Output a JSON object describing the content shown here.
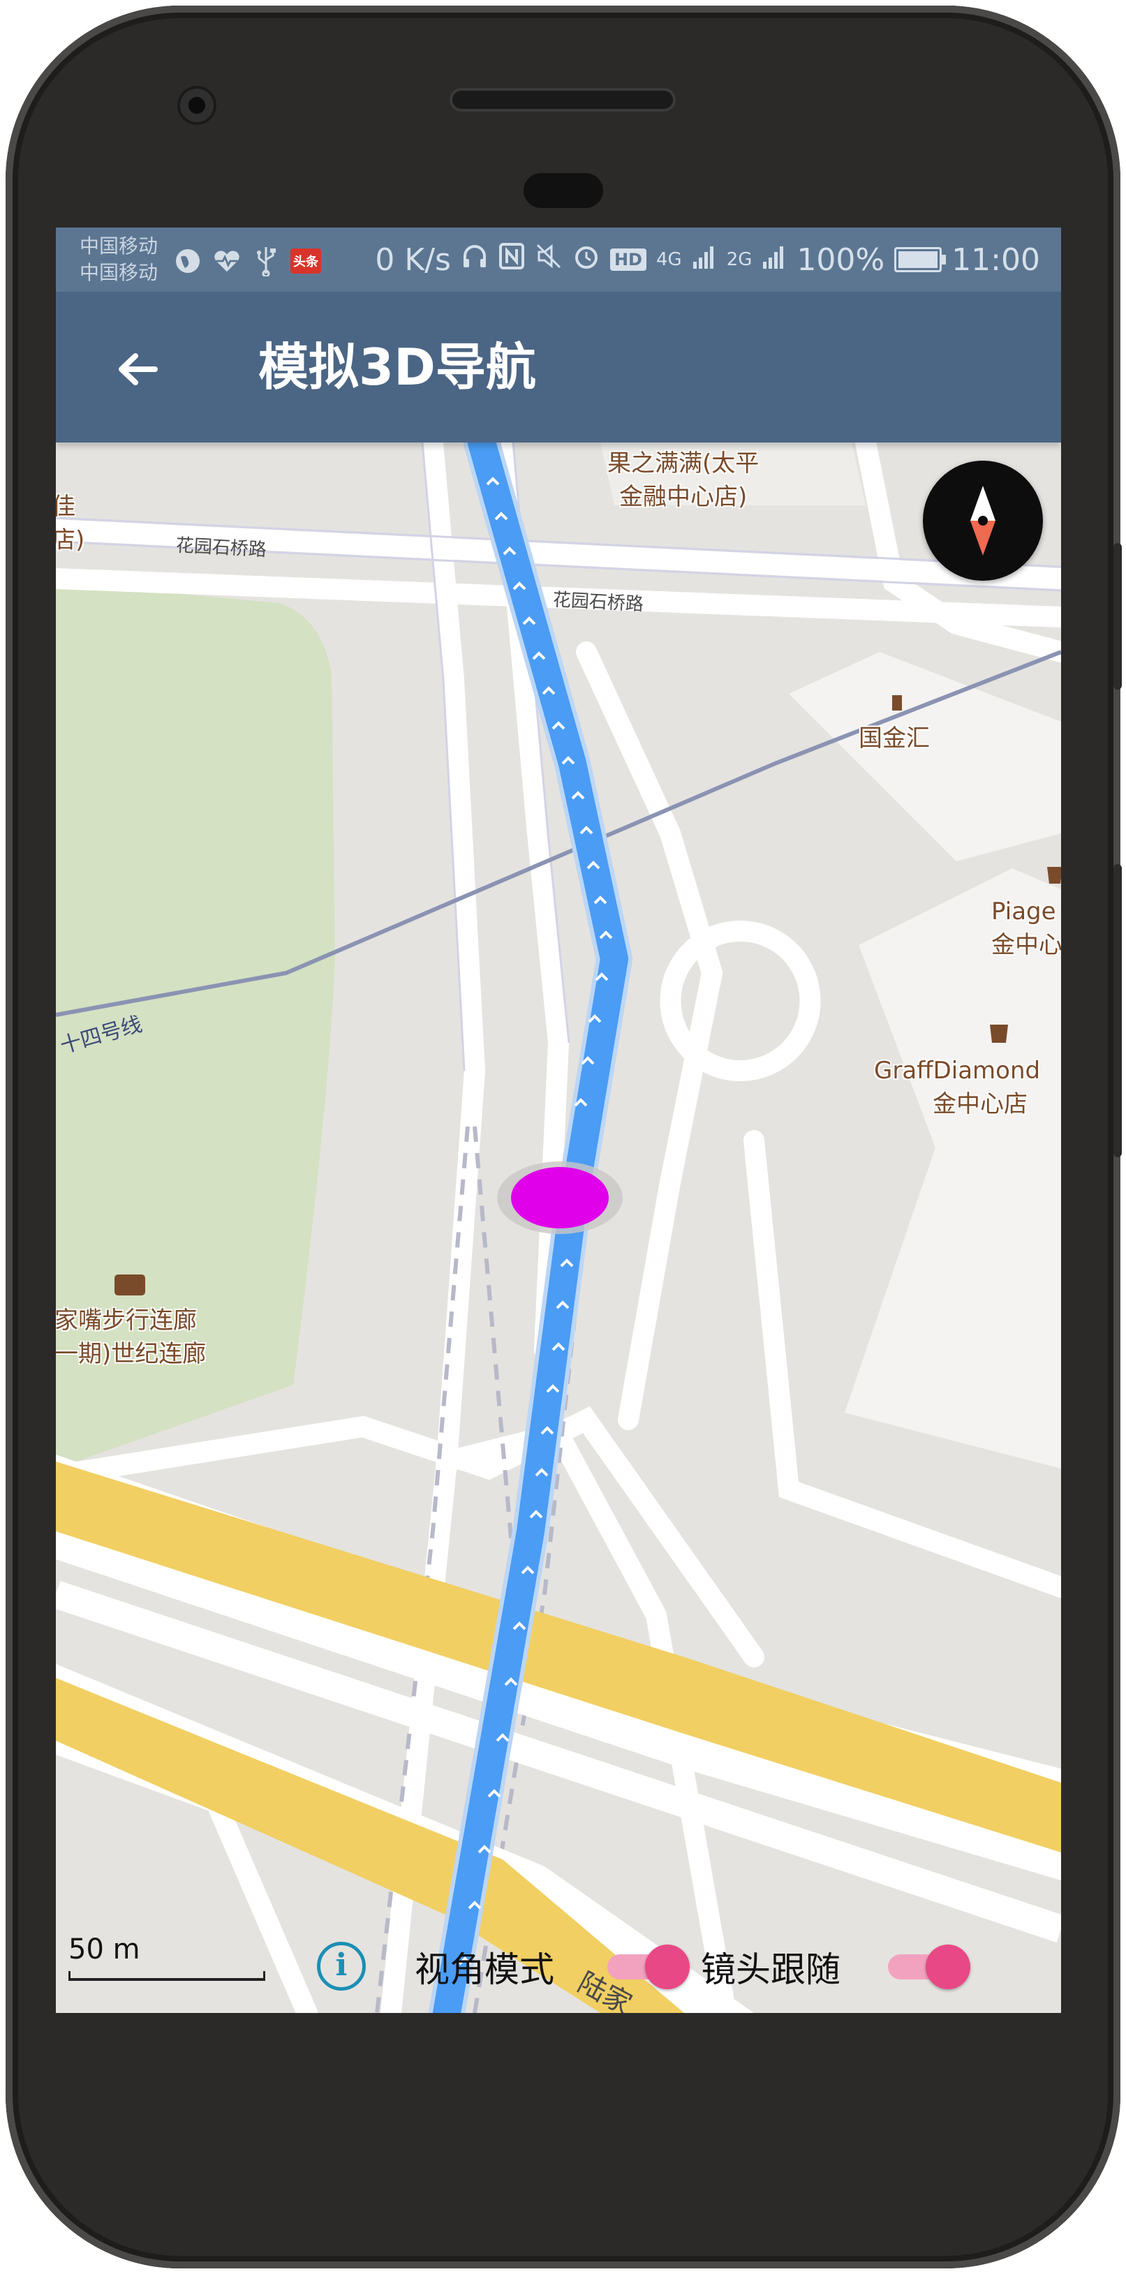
{
  "status_bar": {
    "carrier_1": "中国移动",
    "carrier_2": "中国移动",
    "app_icons": [
      "world-icon",
      "health-icon",
      "usb-icon",
      "toutiao-icon"
    ],
    "toutiao_label": "头条",
    "net_speed": "0 K/s",
    "net_small_4g": "4G",
    "net_small_2g": "2G",
    "hd_label": "HD",
    "battery": "100%",
    "time": "11:00"
  },
  "toolbar": {
    "back_icon": "arrow-left-icon",
    "title": "模拟3D导航"
  },
  "map": {
    "pois": {
      "guojinhui": "国金汇",
      "guozhimanman_1": "果之满满(太平",
      "guozhimanman_2": "金融中心店)",
      "left_edge_1": "佳",
      "left_edge_2": "店)",
      "piaget_1": "Piage",
      "piaget_2": "金中心",
      "graff_1": "GraffDiamond",
      "graff_2": "金中心店",
      "promenade_1": "家嘴步行连廊",
      "promenade_2": "一期)世纪连廊"
    },
    "roads": {
      "huayuan_1": "花园石桥路",
      "huayuan_2": "花园石桥路",
      "metro": "十四号线",
      "bottom": "陆家"
    },
    "colors": {
      "route": "#4a9cf5",
      "vehicle": "#e000ea",
      "main_road": "#f1cf62",
      "park": "#d4e1c2",
      "background": "#e5e3df"
    }
  },
  "controls": {
    "compass_icon": "compass-icon",
    "scale_label": "50 m",
    "info_icon": "info-icon",
    "view_mode_label": "视角模式",
    "view_mode_on": true,
    "camera_follow_label": "镜头跟随",
    "camera_follow_on": true
  }
}
